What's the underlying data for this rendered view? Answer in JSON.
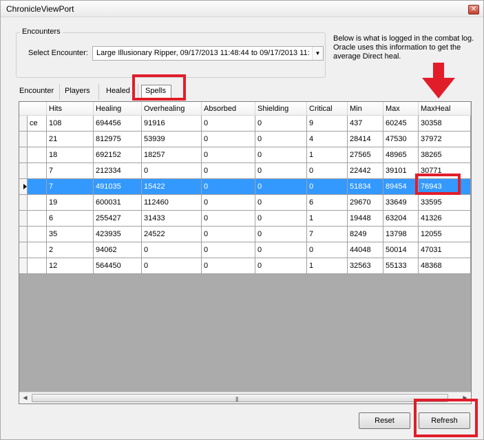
{
  "window": {
    "title": "ChronicleViewPort",
    "close_label": "✕"
  },
  "encounters": {
    "group_label": "Encounters",
    "select_label": "Select Encounter:",
    "selected_value": "Large Illusionary Ripper, 09/17/2013 11:48:44 to 09/17/2013 11:",
    "note": "Below is what is logged in the combat log. Oracle uses this information to get the average Direct heal."
  },
  "tabs": [
    {
      "label": "Encounter"
    },
    {
      "label": "Players"
    },
    {
      "label": "Healed"
    },
    {
      "label": "Spells"
    }
  ],
  "active_tab": "Spells",
  "grid": {
    "columns": [
      "",
      "Hits",
      "Healing",
      "Overhealing",
      "Absorbed",
      "Shielding",
      "Critical",
      "Min",
      "Max",
      "MaxHeal"
    ],
    "rows": [
      [
        "ce",
        "108",
        "694456",
        "91916",
        "0",
        "0",
        "9",
        "437",
        "60245",
        "30358"
      ],
      [
        "",
        "21",
        "812975",
        "53939",
        "0",
        "0",
        "4",
        "28414",
        "47530",
        "37972"
      ],
      [
        "",
        "18",
        "692152",
        "18257",
        "0",
        "0",
        "1",
        "27565",
        "48965",
        "38265"
      ],
      [
        "",
        "7",
        "212334",
        "0",
        "0",
        "0",
        "0",
        "22442",
        "39101",
        "30771"
      ],
      [
        "",
        "7",
        "491035",
        "15422",
        "0",
        "0",
        "0",
        "51834",
        "89454",
        "76943"
      ],
      [
        "",
        "19",
        "600031",
        "112460",
        "0",
        "0",
        "6",
        "29670",
        "33649",
        "33595"
      ],
      [
        "",
        "6",
        "255427",
        "31433",
        "0",
        "0",
        "1",
        "19448",
        "63204",
        "41326"
      ],
      [
        "",
        "35",
        "423935",
        "24522",
        "0",
        "0",
        "7",
        "8249",
        "13798",
        "12055"
      ],
      [
        "",
        "2",
        "94062",
        "0",
        "0",
        "0",
        "0",
        "44048",
        "50014",
        "47031"
      ],
      [
        "",
        "12",
        "564450",
        "0",
        "0",
        "0",
        "1",
        "32563",
        "55133",
        "48368"
      ]
    ],
    "selected_row": 4
  },
  "buttons": {
    "reset": "Reset",
    "refresh": "Refresh"
  },
  "scrollbar": {
    "grip": "|||"
  },
  "colors": {
    "annotation_red": "#e11d2a",
    "selection_blue": "#3399ff"
  }
}
